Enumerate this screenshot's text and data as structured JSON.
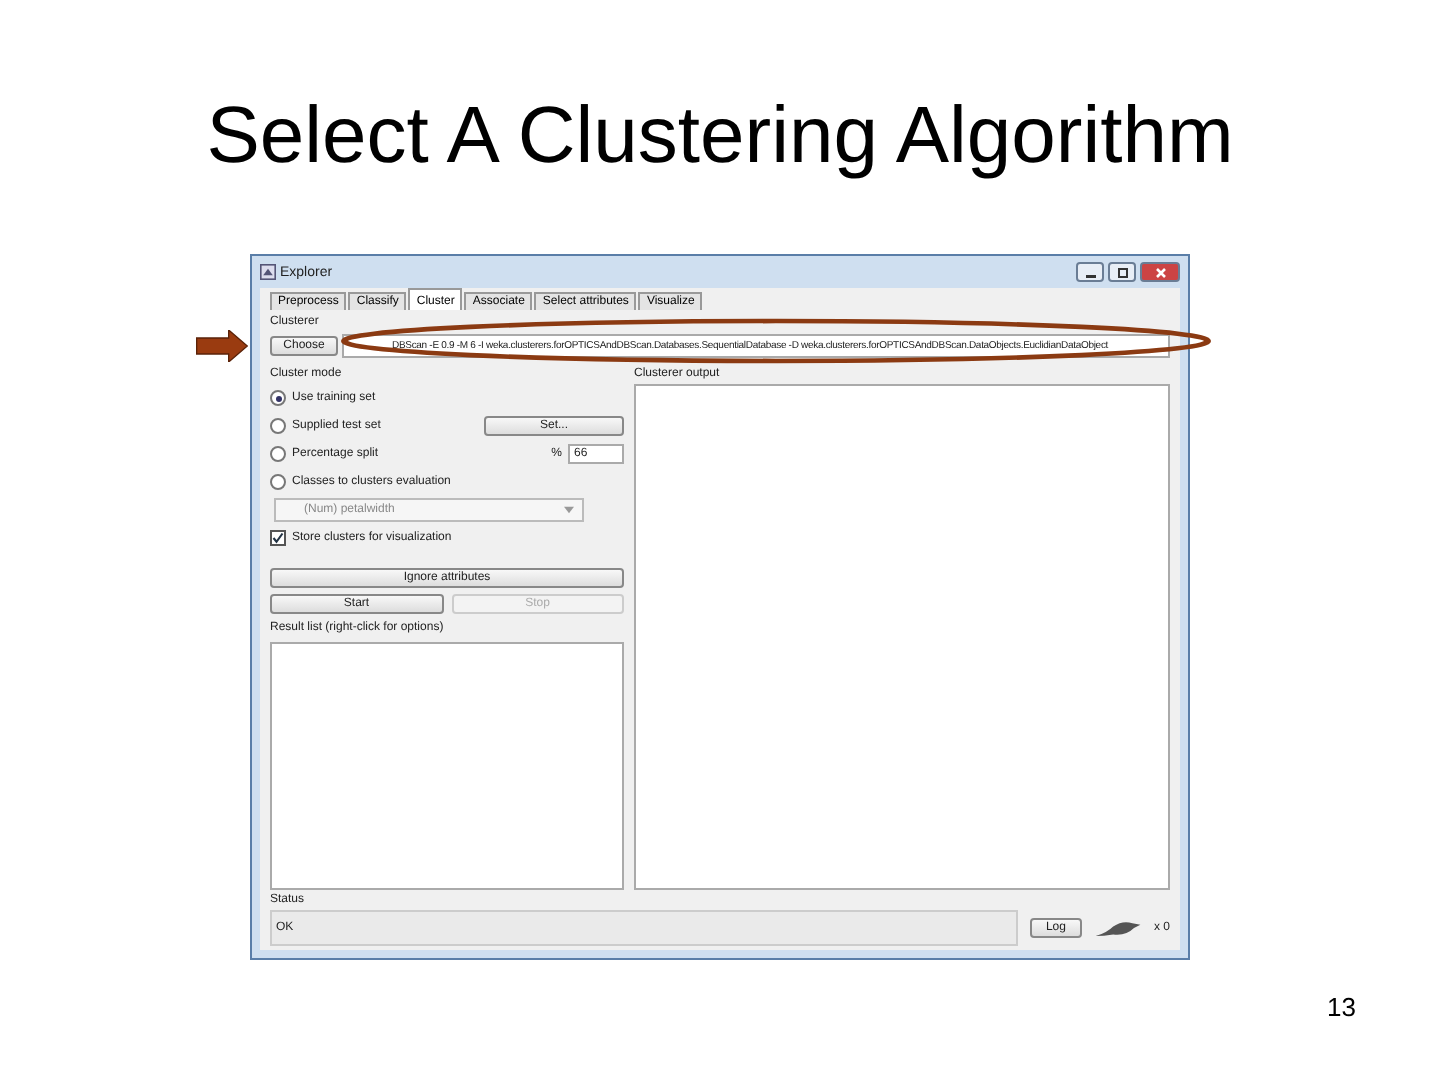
{
  "slide": {
    "title": "Select A Clustering Algorithm",
    "page_number": "13"
  },
  "window": {
    "title": "Explorer",
    "tabs": [
      {
        "label": "Preprocess",
        "selected": false
      },
      {
        "label": "Classify",
        "selected": false
      },
      {
        "label": "Cluster",
        "selected": true
      },
      {
        "label": "Associate",
        "selected": false
      },
      {
        "label": "Select attributes",
        "selected": false
      },
      {
        "label": "Visualize",
        "selected": false
      }
    ]
  },
  "clusterer": {
    "group_label": "Clusterer",
    "choose_button": "Choose",
    "options": "DBScan -E 0.9 -M 6 -I weka.clusterers.forOPTICSAndDBScan.Databases.SequentialDatabase -D weka.clusterers.forOPTICSAndDBScan.DataObjects.EuclidianDataObject"
  },
  "cluster_mode": {
    "group_label": "Cluster mode",
    "options": [
      {
        "label": "Use training set",
        "selected": true
      },
      {
        "label": "Supplied test set",
        "selected": false
      },
      {
        "label": "Percentage split",
        "selected": false
      },
      {
        "label": "Classes to clusters evaluation",
        "selected": false
      }
    ],
    "set_button": "Set...",
    "percent_sign": "%",
    "percent_value": "66",
    "class_dropdown": {
      "value": "(Num) petalwidth",
      "disabled": true
    },
    "store_clusters": {
      "label": "Store clusters for visualization",
      "checked": true
    }
  },
  "ignore_button": "Ignore attributes",
  "start_button": {
    "label": "Start",
    "disabled": false
  },
  "stop_button": {
    "label": "Stop",
    "disabled": true
  },
  "result_list_label": "Result list (right-click for options)",
  "output_label": "Clusterer output",
  "status": {
    "label": "Status",
    "text": "OK",
    "log_button": "Log",
    "count": "x 0"
  }
}
